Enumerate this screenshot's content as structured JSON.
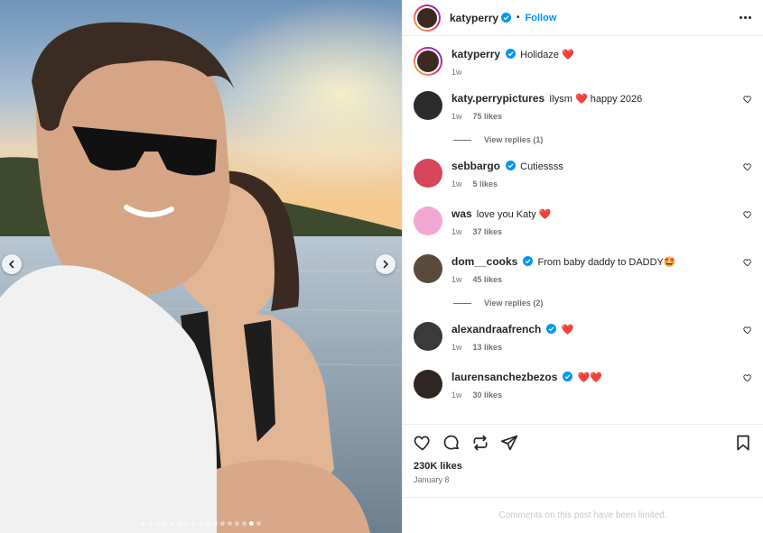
{
  "header": {
    "username": "katyperry",
    "separator": "•",
    "follow_label": "Follow"
  },
  "caption": {
    "username": "katyperry",
    "text": "Holidaze ❤️",
    "time": "1w"
  },
  "comments": [
    {
      "username": "katy.perrypictures",
      "verified": false,
      "text": "Ilysm ❤️ happy 2026",
      "time": "1w",
      "likes": "75 likes",
      "replies": "View replies (1)"
    },
    {
      "username": "sebbargo",
      "verified": true,
      "text": "Cutiessss",
      "time": "1w",
      "likes": "5 likes",
      "replies": null
    },
    {
      "username": "was",
      "verified": false,
      "text": "love you Katy ❤️",
      "time": "1w",
      "likes": "37 likes",
      "replies": null
    },
    {
      "username": "dom__cooks",
      "verified": true,
      "text": "From baby daddy to DADDY🤩",
      "time": "1w",
      "likes": "45 likes",
      "replies": "View replies (2)"
    },
    {
      "username": "alexandraafrench",
      "verified": true,
      "text": "❤️",
      "time": "1w",
      "likes": "13 likes",
      "replies": null
    },
    {
      "username": "laurensanchezbezos",
      "verified": true,
      "text": "❤️❤️",
      "time": "1w",
      "likes": "30 likes",
      "replies": null
    }
  ],
  "footer": {
    "likes": "230K likes",
    "date": "January 8",
    "limited_notice": "Comments on this post have been limited."
  },
  "carousel": {
    "slide_count": 17,
    "active_index": 15
  },
  "colors": {
    "accent": "#0095f6",
    "verified": "#0095f6",
    "heart": "#e0245e",
    "muted": "#737373"
  }
}
